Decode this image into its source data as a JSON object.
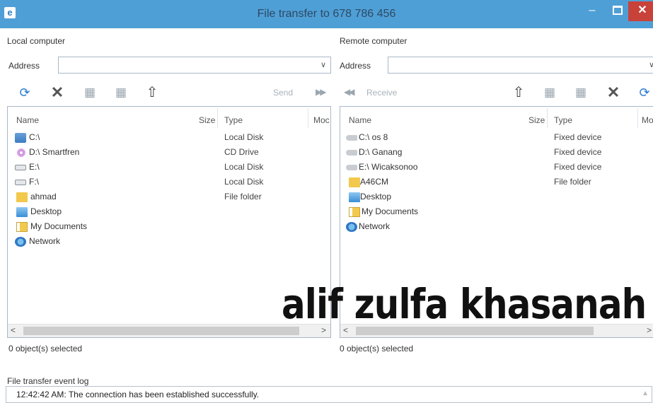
{
  "window": {
    "title": "File transfer to 678 786 456",
    "minimize_icon": "minimize-icon",
    "maximize_icon": "maximize-icon",
    "close_icon": "close-icon",
    "minimize_glyph": "–",
    "close_glyph": "✕"
  },
  "local": {
    "title": "Local computer",
    "address_label": "Address",
    "address_value": "",
    "toolbar": {
      "send_label": "Send"
    },
    "columns": [
      "Name",
      "Size",
      "Type",
      "Moc"
    ],
    "items": [
      {
        "name": "C:\\",
        "type": "Local Disk",
        "icon": "disk-icon"
      },
      {
        "name": "D:\\ Smartfren",
        "type": "CD Drive",
        "icon": "cd-icon"
      },
      {
        "name": "E:\\",
        "type": "Local Disk",
        "icon": "drive-icon"
      },
      {
        "name": "F:\\",
        "type": "Local Disk",
        "icon": "drive-icon"
      },
      {
        "name": "ahmad",
        "type": "File folder",
        "icon": "folder-icon"
      },
      {
        "name": "Desktop",
        "type": "",
        "icon": "desktop-icon"
      },
      {
        "name": "My Documents",
        "type": "",
        "icon": "documents-icon"
      },
      {
        "name": "Network",
        "type": "",
        "icon": "network-icon"
      }
    ],
    "status": "0 object(s) selected"
  },
  "remote": {
    "title": "Remote computer",
    "address_label": "Address",
    "address_value": "",
    "toolbar": {
      "receive_label": "Receive"
    },
    "columns": [
      "Name",
      "Size",
      "Type",
      "Mo"
    ],
    "items": [
      {
        "name": "C:\\ os 8",
        "type": "Fixed device",
        "icon": "hard-drive-icon"
      },
      {
        "name": "D:\\ Ganang",
        "type": "Fixed device",
        "icon": "hard-drive-icon"
      },
      {
        "name": "E:\\ Wicaksonoo",
        "type": "Fixed device",
        "icon": "hard-drive-icon"
      },
      {
        "name": "A46CM",
        "type": "File folder",
        "icon": "folder-icon"
      },
      {
        "name": "Desktop",
        "type": "",
        "icon": "desktop-icon"
      },
      {
        "name": "My Documents",
        "type": "",
        "icon": "documents-icon"
      },
      {
        "name": "Network",
        "type": "",
        "icon": "network-icon"
      }
    ],
    "status": "0 object(s) selected"
  },
  "event_log": {
    "label": "File transfer event log",
    "entries": [
      "12:42:42 AM: The connection has been established successfully."
    ]
  },
  "watermark": "alif zulfa khasanah",
  "colors": {
    "titlebar": "#4f9fd7",
    "close_button": "#c8423a",
    "panel_border": "#a9b8c8"
  }
}
